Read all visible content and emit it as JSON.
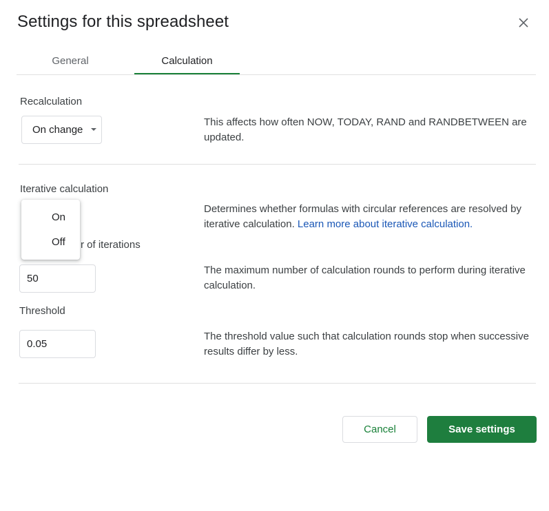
{
  "dialog": {
    "title": "Settings for this spreadsheet"
  },
  "tabs": [
    {
      "label": "General",
      "selected": false
    },
    {
      "label": "Calculation",
      "selected": true
    }
  ],
  "recalculation": {
    "label": "Recalculation",
    "selected_value": "On change",
    "description": "This affects how often NOW, TODAY, RAND and RANDBETWEEN are updated."
  },
  "iterative": {
    "label": "Iterative calculation",
    "description": "Determines whether formulas with circular references are resolved by iterative calculation.",
    "learn_more_link": "Learn more about iterative calculation.",
    "dropdown_options": [
      "On",
      "Off"
    ]
  },
  "max_iterations": {
    "label_visible": "r of iterations",
    "value": "50",
    "description": "The maximum number of calculation rounds to perform during iterative calculation."
  },
  "threshold": {
    "label": "Threshold",
    "value": "0.05",
    "description": "The threshold value such that calculation rounds stop when successive results differ by less."
  },
  "buttons": {
    "cancel": "Cancel",
    "save": "Save settings"
  },
  "colors": {
    "accent": "#188038",
    "primary_button": "#1e7e3e",
    "link": "#1a57b6"
  },
  "icons": {
    "close": "close-icon",
    "dropdown": "caret-down-icon"
  }
}
